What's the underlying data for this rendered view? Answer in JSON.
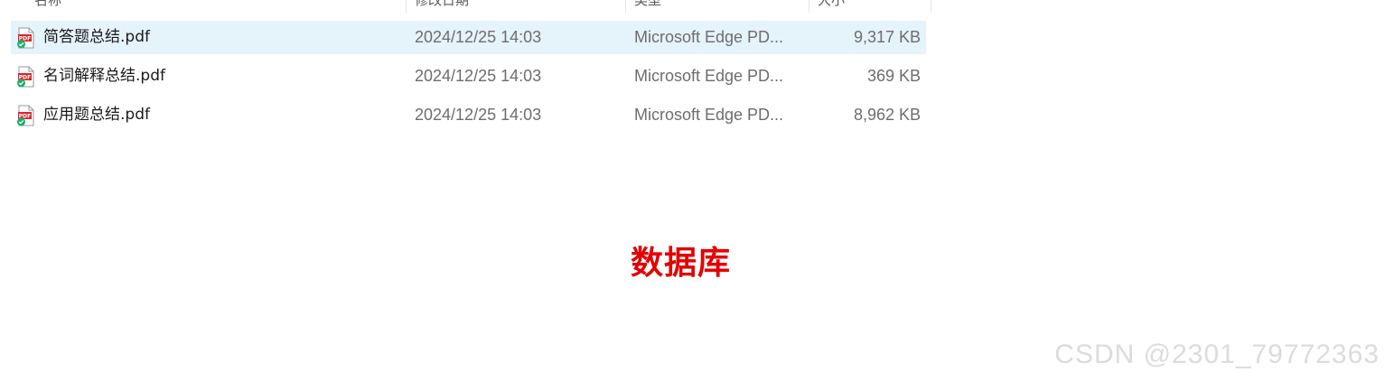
{
  "columns": [
    "名称",
    "修改日期",
    "类型",
    "大小"
  ],
  "files": [
    {
      "name": "简答题总结.pdf",
      "modified": "2024/12/25 14:03",
      "type": "Microsoft Edge PD...",
      "size": "9,317 KB",
      "selected": true,
      "icon": "pdf-file-synced-icon"
    },
    {
      "name": "名词解释总结.pdf",
      "modified": "2024/12/25 14:03",
      "type": "Microsoft Edge PD...",
      "size": "369 KB",
      "selected": false,
      "icon": "pdf-file-synced-icon"
    },
    {
      "name": "应用题总结.pdf",
      "modified": "2024/12/25 14:03",
      "type": "Microsoft Edge PD...",
      "size": "8,962 KB",
      "selected": false,
      "icon": "pdf-file-synced-icon"
    }
  ],
  "caption": "数据库",
  "watermark": "CSDN @2301_79772363",
  "colors": {
    "selection": "#e5f3fb",
    "caption": "#e30000",
    "pdf_red": "#d6262b",
    "sync_green": "#17b26a"
  }
}
